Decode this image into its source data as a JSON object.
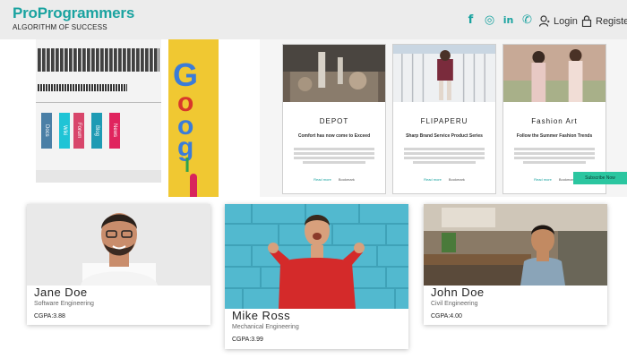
{
  "brand": {
    "name": "ProProgrammers",
    "tagline": "ALGORITHM OF SUCCESS",
    "accent": "#1aa3a0"
  },
  "socials": [
    {
      "name": "facebook-icon",
      "glyph": "f"
    },
    {
      "name": "instagram-icon",
      "glyph": "◎"
    },
    {
      "name": "linkedin-icon",
      "glyph": "in"
    },
    {
      "name": "whatsapp-icon",
      "glyph": "✆"
    }
  ],
  "nav": {
    "login": "Login",
    "register": "Register"
  },
  "promo": {
    "buttons": [
      {
        "label": "Docs",
        "color": "#4a7fa6"
      },
      {
        "label": "Wiki",
        "color": "#1fc4d6"
      },
      {
        "label": "Forum",
        "color": "#d8466b"
      },
      {
        "label": "Blog",
        "color": "#1e9bb4"
      },
      {
        "label": "News",
        "color": "#e0245e"
      }
    ]
  },
  "google": {
    "letters": [
      {
        "ch": "G",
        "color": "#3b7cd8"
      },
      {
        "ch": "o",
        "color": "#d8372b"
      },
      {
        "ch": "o",
        "color": "#3b7cd8"
      },
      {
        "ch": "g",
        "color": "#3b7cd8"
      },
      {
        "ch": "l",
        "color": "#2fa24e"
      },
      {
        "ch": "e",
        "color": "#d8372b"
      }
    ]
  },
  "feature_cards": [
    {
      "title": "DEPOT",
      "subtitle": "Comfort has now come to Exceed",
      "actions": [
        "Read more",
        "Bookmark"
      ]
    },
    {
      "title": "FLIPAPERU",
      "subtitle": "Sharp Brand Service Product Series",
      "actions": [
        "Read more",
        "Bookmark"
      ]
    },
    {
      "title": "Fashion Art",
      "subtitle": "Follow the Summer Fashion Trends",
      "actions": [
        "Read more",
        "Bookmark"
      ]
    }
  ],
  "teal_button": "Subscribe Now",
  "students": [
    {
      "name": "Jane Doe",
      "major": "Software Engineering",
      "gpa": "CGPA:3.88"
    },
    {
      "name": "Mike Ross",
      "major": "Mechanical Engineering",
      "gpa": "CGPA:3.99"
    },
    {
      "name": "John Doe",
      "major": "Civil Engineering",
      "gpa": "CGPA:4.00"
    }
  ]
}
